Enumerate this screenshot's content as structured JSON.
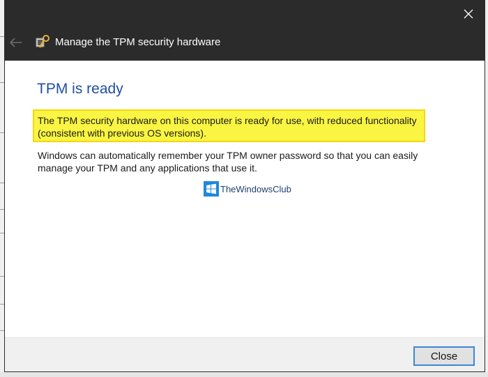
{
  "window": {
    "title": "Manage the TPM security hardware",
    "close_icon": "close-icon",
    "back_icon": "back-arrow-icon",
    "app_icon": "tpm-chip-icon"
  },
  "content": {
    "heading": "TPM is ready",
    "highlight_line1": "The TPM security hardware on this computer is ready for use, with reduced functionality",
    "highlight_line2": "(consistent with previous OS versions).",
    "para_line1": "Windows can automatically remember your TPM owner password so that you can easily",
    "para_line2": "manage your TPM and any applications that use it."
  },
  "watermark": {
    "text": "TheWindowsClub"
  },
  "footer": {
    "close_label": "Close"
  },
  "colors": {
    "titlebar": "#2b2b2b",
    "heading": "#1f4e9e",
    "highlight_fill": "#faf542",
    "highlight_border": "#f5d60f",
    "button_border": "#3b86d6"
  }
}
